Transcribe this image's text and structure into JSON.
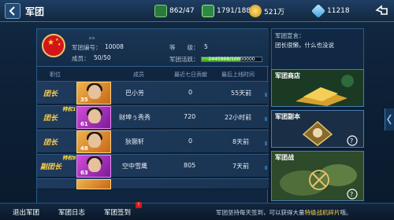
{
  "topbar": {
    "title": "军团",
    "resources": [
      {
        "icon": "barracks-icon",
        "value": "862/47"
      },
      {
        "icon": "tank-icon",
        "value": "1791/188"
      },
      {
        "icon": "gold-coin-icon",
        "value": "521万"
      },
      {
        "icon": "diamond-icon",
        "value": "11218"
      }
    ]
  },
  "guild": {
    "name": "。。",
    "id_label": "军团编号：",
    "id_value": "10008",
    "level_label": "等　　级：",
    "level_value": "5",
    "members_label": "成员：",
    "members_value": "50/50",
    "activity_label": "军团活跃：",
    "activity_text": "2445968/10000000",
    "activity_fraction": 0.64
  },
  "columns": {
    "position": "职位",
    "member": "成员",
    "weekly": "最近七日贡献",
    "online": "最后上线时间"
  },
  "members": [
    {
      "rank": "团长",
      "special": "",
      "level": "35",
      "name": "巴小芳",
      "weekly": "0",
      "online": "55天前"
    },
    {
      "rank": "团长",
      "special": "特权1",
      "level": "61",
      "name": "财坤ぅ秀秀",
      "weekly": "720",
      "online": "22小时前"
    },
    {
      "rank": "团长",
      "special": "",
      "level": "48",
      "name": "狄颢轩",
      "weekly": "0",
      "online": "8天前"
    },
    {
      "rank": "副团长",
      "special": "特权8",
      "level": "63",
      "name": "空中雪鹰",
      "weekly": "805",
      "online": "7天前"
    }
  ],
  "announcement": {
    "title": "军团宣言：",
    "text": "团长很懒，什么也没说"
  },
  "cards": [
    {
      "title": "军团商店"
    },
    {
      "title": "军团副本"
    },
    {
      "title": "军团战"
    }
  ],
  "bottom": {
    "quit": "退出军团",
    "log": "军团日志",
    "checkin": "军团签到",
    "badge": "!",
    "notice_pre": "军团坚持每天签到，可以获得大量",
    "notice_highlight": "特级战机碎片",
    "notice_post": "哦。"
  }
}
